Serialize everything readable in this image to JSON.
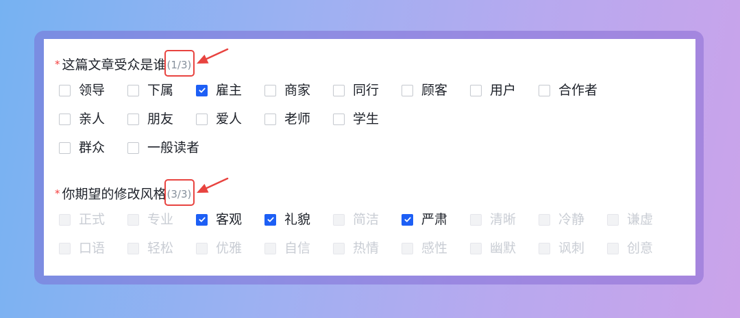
{
  "sections": [
    {
      "required_mark": "*",
      "title": "这篇文章受众是谁",
      "count": "(1/3)",
      "rows": [
        [
          {
            "label": "领导",
            "checked": false,
            "disabled": false
          },
          {
            "label": "下属",
            "checked": false,
            "disabled": false
          },
          {
            "label": "雇主",
            "checked": true,
            "disabled": false
          },
          {
            "label": "商家",
            "checked": false,
            "disabled": false
          },
          {
            "label": "同行",
            "checked": false,
            "disabled": false
          },
          {
            "label": "顾客",
            "checked": false,
            "disabled": false
          },
          {
            "label": "用户",
            "checked": false,
            "disabled": false
          },
          {
            "label": "合作者",
            "checked": false,
            "disabled": false
          }
        ],
        [
          {
            "label": "亲人",
            "checked": false,
            "disabled": false
          },
          {
            "label": "朋友",
            "checked": false,
            "disabled": false
          },
          {
            "label": "爱人",
            "checked": false,
            "disabled": false
          },
          {
            "label": "老师",
            "checked": false,
            "disabled": false
          },
          {
            "label": "学生",
            "checked": false,
            "disabled": false
          }
        ],
        [
          {
            "label": "群众",
            "checked": false,
            "disabled": false
          },
          {
            "label": "一般读者",
            "checked": false,
            "disabled": false
          }
        ]
      ]
    },
    {
      "required_mark": "*",
      "title": "你期望的修改风格",
      "count": "(3/3)",
      "rows": [
        [
          {
            "label": "正式",
            "checked": false,
            "disabled": true
          },
          {
            "label": "专业",
            "checked": false,
            "disabled": true
          },
          {
            "label": "客观",
            "checked": true,
            "disabled": false
          },
          {
            "label": "礼貌",
            "checked": true,
            "disabled": false
          },
          {
            "label": "简洁",
            "checked": false,
            "disabled": true
          },
          {
            "label": "严肃",
            "checked": true,
            "disabled": false
          },
          {
            "label": "清晰",
            "checked": false,
            "disabled": true
          },
          {
            "label": "冷静",
            "checked": false,
            "disabled": true
          },
          {
            "label": "谦虚",
            "checked": false,
            "disabled": true
          }
        ],
        [
          {
            "label": "口语",
            "checked": false,
            "disabled": true
          },
          {
            "label": "轻松",
            "checked": false,
            "disabled": true
          },
          {
            "label": "优雅",
            "checked": false,
            "disabled": true
          },
          {
            "label": "自信",
            "checked": false,
            "disabled": true
          },
          {
            "label": "热情",
            "checked": false,
            "disabled": true
          },
          {
            "label": "感性",
            "checked": false,
            "disabled": true
          },
          {
            "label": "幽默",
            "checked": false,
            "disabled": true
          },
          {
            "label": "讽刺",
            "checked": false,
            "disabled": true
          },
          {
            "label": "创意",
            "checked": false,
            "disabled": true
          }
        ]
      ]
    }
  ],
  "colors": {
    "text": "#1d2129",
    "muted": "#86909c",
    "required": "#f53f3f",
    "checked": "#1d5ff5",
    "disabled_text": "#c9cdd4",
    "annotation": "#e8433f"
  }
}
